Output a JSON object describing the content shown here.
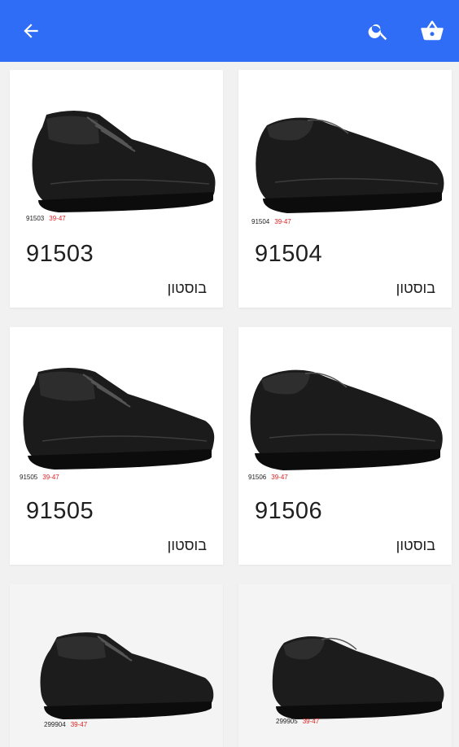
{
  "appbar": {
    "color": "#2f6df6",
    "back_icon": "arrow-left-icon",
    "search_icon": "search-icon",
    "cart_icon": "basket-icon"
  },
  "products": [
    {
      "code_small": "91503",
      "size_range": "39-47",
      "title": "91503",
      "brand": "בוסטון",
      "shoe": "lace-up"
    },
    {
      "code_small": "91504",
      "size_range": "39-47",
      "title": "91504",
      "brand": "בוסטון",
      "shoe": "slip-on"
    },
    {
      "code_small": "91505",
      "size_range": "39-47",
      "title": "91505",
      "brand": "בוסטון",
      "shoe": "lace-up"
    },
    {
      "code_small": "91506",
      "size_range": "39-47",
      "title": "91506",
      "brand": "בוסטון",
      "shoe": "slip-on"
    },
    {
      "code_small": "299904",
      "size_range": "39-47",
      "title": "",
      "brand": "",
      "shoe": "lace-up"
    },
    {
      "code_small": "299905",
      "size_range": "39-47",
      "title": "",
      "brand": "",
      "shoe": "slip-on"
    }
  ]
}
